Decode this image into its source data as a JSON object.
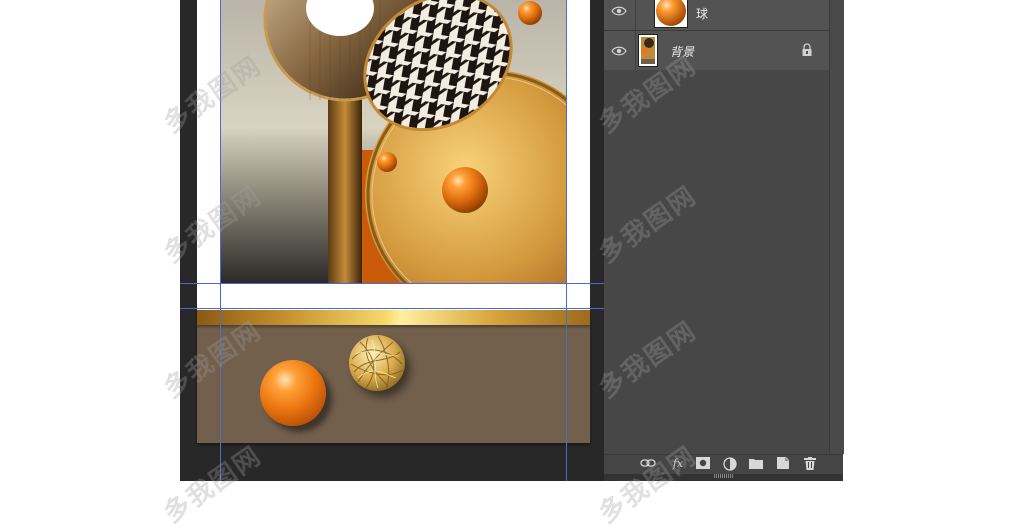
{
  "layers_panel": {
    "layers": [
      {
        "name": "球",
        "visible": true,
        "locked": false,
        "thumb": "orange-ball"
      },
      {
        "name": "背景",
        "visible": true,
        "locked": true,
        "thumb": "artwork"
      }
    ],
    "footer_icons": [
      "link-layers-icon",
      "fx-icon",
      "add-mask-icon",
      "adjustment-layer-icon",
      "new-group-icon",
      "new-layer-icon",
      "delete-layer-icon"
    ],
    "fx_label": "fx"
  },
  "watermark": {
    "text": "多我图网"
  },
  "colors": {
    "workspace": "#282828",
    "panel": "#535353",
    "guide": "#4a6ec8",
    "brown_panel": "#725f4c",
    "orange": "#ee7a12",
    "gold": "#d8a63c"
  }
}
